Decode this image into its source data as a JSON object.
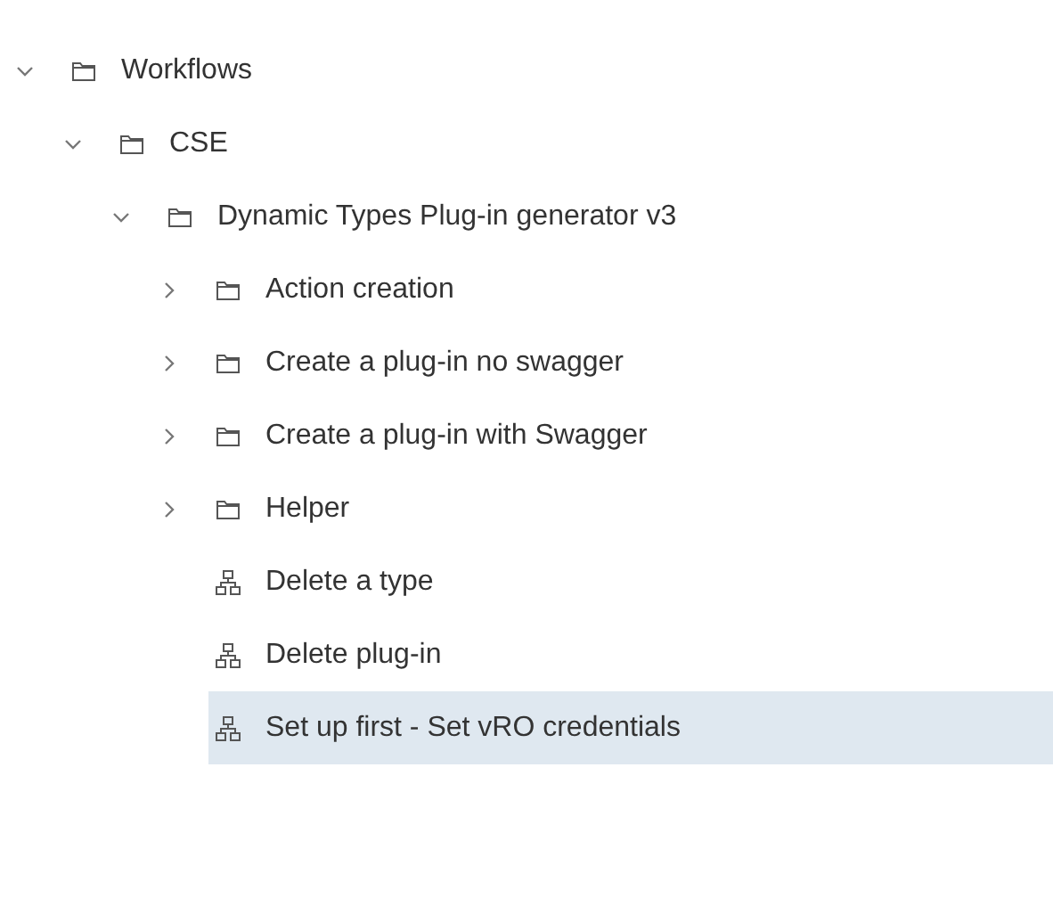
{
  "tree": [
    {
      "kind": "folder",
      "label": "Workflows",
      "expanded": true,
      "selected": false,
      "children": [
        {
          "kind": "folder",
          "label": "CSE",
          "expanded": true,
          "selected": false,
          "children": [
            {
              "kind": "folder",
              "label": "Dynamic Types Plug-in generator v3",
              "expanded": true,
              "selected": false,
              "children": [
                {
                  "kind": "folder",
                  "label": "Action creation",
                  "expanded": false,
                  "selected": false
                },
                {
                  "kind": "folder",
                  "label": "Create a plug-in no swagger",
                  "expanded": false,
                  "selected": false
                },
                {
                  "kind": "folder",
                  "label": "Create a plug-in with Swagger",
                  "expanded": false,
                  "selected": false
                },
                {
                  "kind": "folder",
                  "label": "Helper",
                  "expanded": false,
                  "selected": false
                },
                {
                  "kind": "workflow",
                  "label": "Delete a type",
                  "selected": false
                },
                {
                  "kind": "workflow",
                  "label": "Delete plug-in",
                  "selected": false
                },
                {
                  "kind": "workflow",
                  "label": "Set up first - Set vRO credentials",
                  "selected": true
                }
              ]
            }
          ]
        }
      ]
    }
  ]
}
